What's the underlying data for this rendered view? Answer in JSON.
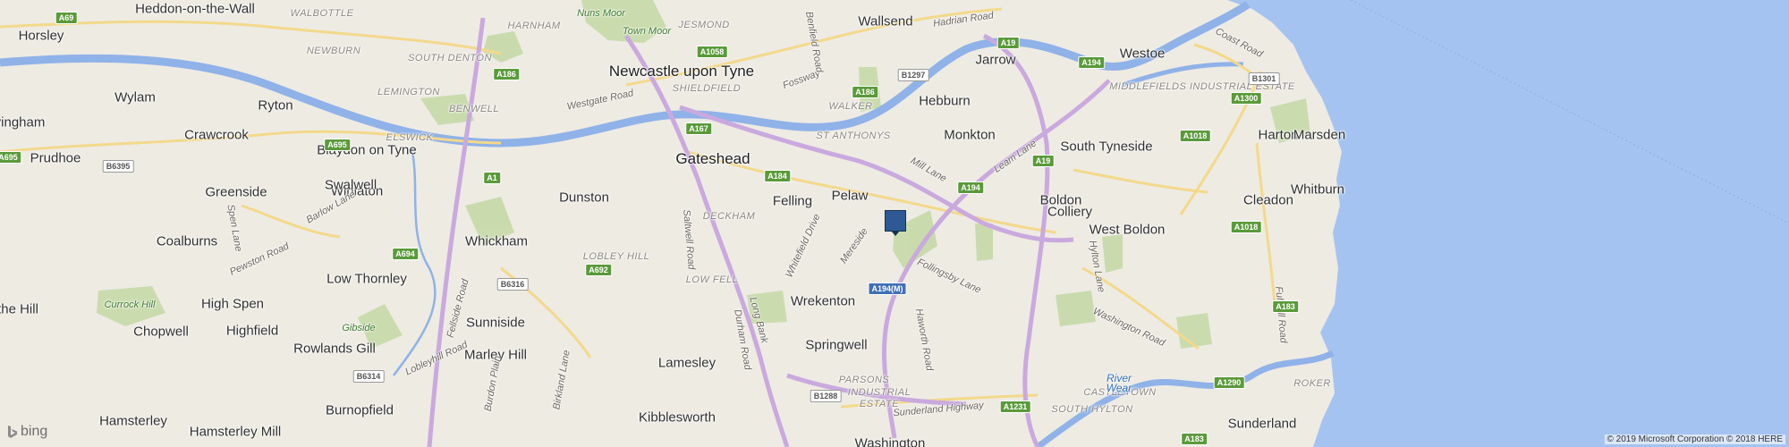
{
  "map": {
    "place_labels": [
      {
        "text": "Heddon-on-the-Wall",
        "kind": "town"
      },
      {
        "text": "Horsley",
        "kind": "town"
      },
      {
        "text": "Wylam",
        "kind": "town"
      },
      {
        "text": "vingham",
        "kind": "town"
      },
      {
        "text": "Prudhoe",
        "kind": "town"
      },
      {
        "text": "Ryton",
        "kind": "town"
      },
      {
        "text": "Crawcrook",
        "kind": "town"
      },
      {
        "text": "Blaydon on Tyne",
        "kind": "town"
      },
      {
        "text": "Greenside",
        "kind": "town"
      },
      {
        "text": "Winlaton",
        "kind": "town"
      },
      {
        "text": "Swalwell",
        "kind": "town"
      },
      {
        "text": "Dunston",
        "kind": "town"
      },
      {
        "text": "Coalburns",
        "kind": "town"
      },
      {
        "text": "Whickham",
        "kind": "town"
      },
      {
        "text": "Low Thornley",
        "kind": "town"
      },
      {
        "text": "the Hill",
        "kind": "town"
      },
      {
        "text": "High Spen",
        "kind": "town"
      },
      {
        "text": "Sunniside",
        "kind": "town"
      },
      {
        "text": "Chopwell",
        "kind": "town"
      },
      {
        "text": "Highfield",
        "kind": "town"
      },
      {
        "text": "Rowlands Gill",
        "kind": "town"
      },
      {
        "text": "Marley Hill",
        "kind": "town"
      },
      {
        "text": "Lamesley",
        "kind": "town"
      },
      {
        "text": "Burnopfield",
        "kind": "town"
      },
      {
        "text": "Hamsterley",
        "kind": "town"
      },
      {
        "text": "Hamsterley Mill",
        "kind": "town"
      },
      {
        "text": "Kibblesworth",
        "kind": "town"
      },
      {
        "text": "Wallsend",
        "kind": "town"
      },
      {
        "text": "Newcastle upon Tyne",
        "kind": "city"
      },
      {
        "text": "Gateshead",
        "kind": "city"
      },
      {
        "text": "Jarrow",
        "kind": "town"
      },
      {
        "text": "Westoe",
        "kind": "town"
      },
      {
        "text": "Hebburn",
        "kind": "town"
      },
      {
        "text": "Monkton",
        "kind": "town"
      },
      {
        "text": "Felling",
        "kind": "town"
      },
      {
        "text": "Pelaw",
        "kind": "town"
      },
      {
        "text": "South Tyneside",
        "kind": "town"
      },
      {
        "text": "Harton",
        "kind": "town"
      },
      {
        "text": "Marsden",
        "kind": "town"
      },
      {
        "text": "Boldon",
        "kind": "town"
      },
      {
        "text": "Colliery",
        "kind": "town"
      },
      {
        "text": "West Boldon",
        "kind": "town"
      },
      {
        "text": "Cleadon",
        "kind": "town"
      },
      {
        "text": "Whitburn",
        "kind": "town"
      },
      {
        "text": "Wrekenton",
        "kind": "town"
      },
      {
        "text": "Springwell",
        "kind": "town"
      },
      {
        "text": "Sunderland",
        "kind": "town"
      },
      {
        "text": "Washington",
        "kind": "town"
      }
    ],
    "district_labels": [
      "WALBOTTLE",
      "HARNHAM",
      "JESMOND",
      "NEWBURN",
      "SOUTH DENTON",
      "LEMINGTON",
      "BENWELL",
      "ELSWICK",
      "SHIELDFIELD",
      "WALKER",
      "ST ANTHONYS",
      "DECKHAM",
      "LOW FELL",
      "LOBLEY HILL",
      "MIDDLEFIELDS INDUSTRIAL ESTATE",
      "PARSONS",
      "INDUSTRIAL",
      "ESTATE",
      "CASTLETOWN",
      "SOUTH HYLTON",
      "ROKER"
    ],
    "road_labels": [
      "Hadrian Road",
      "Westgate Road",
      "Fossway",
      "Coast Road",
      "Mill Lane",
      "Leam Lane",
      "Barlow Lane",
      "Spen Lane",
      "Pewston Road",
      "Fellside Road",
      "Lobleyhill Road",
      "Burdon Plain",
      "Birkland Lane",
      "Saltwell Road",
      "Durham Road",
      "Long Bank",
      "Whitefield Drive",
      "Mereside",
      "Follingsby Lane",
      "Hylton Lane",
      "Washington Road",
      "Haworth Road",
      "Sunderland Highway",
      "Fulwell Road",
      "Benfield Road"
    ],
    "green_labels": [
      "Nuns Moor",
      "Town Moor",
      "Currock Hill",
      "Gibside"
    ],
    "water_labels": [
      "River",
      "Wear"
    ],
    "route_badges": [
      {
        "text": "A69",
        "type": "A"
      },
      {
        "text": "A695",
        "type": "A"
      },
      {
        "text": "A695",
        "type": "A"
      },
      {
        "text": "B6395",
        "type": "B"
      },
      {
        "text": "A1",
        "type": "A"
      },
      {
        "text": "A186",
        "type": "A"
      },
      {
        "text": "A1058",
        "type": "A"
      },
      {
        "text": "A167",
        "type": "A"
      },
      {
        "text": "A186",
        "type": "A"
      },
      {
        "text": "B1297",
        "type": "B"
      },
      {
        "text": "A19",
        "type": "A"
      },
      {
        "text": "A194",
        "type": "A"
      },
      {
        "text": "B1301",
        "type": "B"
      },
      {
        "text": "A1300",
        "type": "A"
      },
      {
        "text": "A1018",
        "type": "A"
      },
      {
        "text": "A184",
        "type": "A"
      },
      {
        "text": "A194",
        "type": "A"
      },
      {
        "text": "A19",
        "type": "A"
      },
      {
        "text": "A1018",
        "type": "A"
      },
      {
        "text": "A694",
        "type": "A"
      },
      {
        "text": "A692",
        "type": "A"
      },
      {
        "text": "B6316",
        "type": "B"
      },
      {
        "text": "B6314",
        "type": "B"
      },
      {
        "text": "A194(M)",
        "type": "M"
      },
      {
        "text": "B1288",
        "type": "B"
      },
      {
        "text": "A1231",
        "type": "A"
      },
      {
        "text": "A1290",
        "type": "A"
      },
      {
        "text": "A183",
        "type": "A"
      },
      {
        "text": "A183",
        "type": "A"
      }
    ]
  },
  "brand": {
    "name": "bing"
  },
  "attribution": {
    "text": "© 2019 Microsoft Corporation © 2018 HERE"
  },
  "marker": {
    "icon": "location-pin-icon",
    "color": "#2d5a94"
  },
  "colors": {
    "land": "#eeebe3",
    "sea": "#a5c3f0",
    "river": "#8fb2e8",
    "motorway": "#c9a9de",
    "main_road": "#f3d98a",
    "park": "#c3d9a4"
  }
}
